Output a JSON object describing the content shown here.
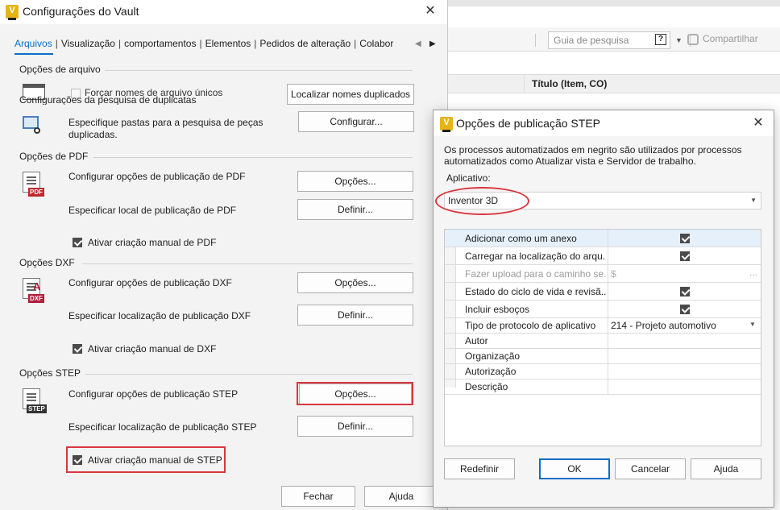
{
  "background_app": {
    "search_placeholder": "Guia de pesquisa",
    "search_help": "?",
    "share_label": "Compartilhar",
    "grid_column_title": "Título (Item, CO)"
  },
  "vault_dialog": {
    "title": "Configurações do Vault",
    "close_glyph": "✕",
    "tabs": [
      "Arquivos",
      "Visualização",
      "comportamentos",
      "Elementos",
      "Pedidos de alteração",
      "Colabor"
    ],
    "tab_separator": "|",
    "tab_scroll_left": "◀",
    "tab_scroll_right": "▶",
    "file_options": {
      "header": "Opções de arquivo",
      "force_unique_label": "Forçar nomes de arquivo únicos",
      "find_duplicates_button": "Localizar nomes duplicados",
      "duplicate_search_overlap": "Configurações da pesquisa de duplicatas",
      "folders_text": "Especifique pastas para a pesquisa de peças duplicadas.",
      "configure_button": "Configurar..."
    },
    "pdf": {
      "header": "Opções de PDF",
      "configure_text": "Configurar opções de publicação de PDF",
      "options_button": "Opções...",
      "location_text": "Especificar local de publicação de PDF",
      "define_button": "Definir...",
      "manual_label": "Ativar criação manual de PDF",
      "badge": "PDF"
    },
    "dxf": {
      "header": "Opções DXF",
      "configure_text": "Configurar opções de publicação DXF",
      "options_button": "Opções...",
      "location_text": "Especificar localização de publicação DXF",
      "define_button": "Definir...",
      "manual_label": "Ativar criação manual de DXF",
      "badge": "DXF",
      "badge_letter": "A"
    },
    "step": {
      "header": "Opções STEP",
      "configure_text": "Configurar opções de publicação STEP",
      "options_button": "Opções...",
      "location_text": "Especificar localização de publicação STEP",
      "define_button": "Definir...",
      "manual_label": "Ativar criação manual de STEP",
      "badge": "STEP"
    },
    "close_button": "Fechar",
    "help_button": "Ajuda"
  },
  "step_dialog": {
    "title": "Opções de publicação STEP",
    "close_glyph": "✕",
    "description": "Os processos automatizados em negrito são utilizados por processos automatizados como Atualizar vista e Servidor de trabalho.",
    "app_label": "Aplicativo:",
    "app_value": "Inventor 3D",
    "app_arrow": "▼",
    "properties": [
      {
        "name": "Adicionar como um anexo",
        "type": "check",
        "checked": true,
        "enabled": true,
        "selected": true
      },
      {
        "name": "Carregar na localização do arqu...",
        "type": "check",
        "checked": true,
        "enabled": true
      },
      {
        "name": "Fazer upload para o caminho se...",
        "type": "text",
        "value": "$",
        "extra": "...",
        "enabled": false
      },
      {
        "name": "Estado do ciclo de vida e revisã...",
        "type": "check",
        "checked": true,
        "enabled": true
      },
      {
        "name": "Incluir esboços",
        "type": "check",
        "checked": true,
        "enabled": true
      },
      {
        "name": "Tipo de protocolo de aplicativo",
        "type": "select",
        "value": "214 - Projeto automotivo",
        "arrow": "▼",
        "enabled": true
      },
      {
        "name": "Autor",
        "type": "text",
        "value": "",
        "enabled": true
      },
      {
        "name": "Organização",
        "type": "text",
        "value": "",
        "enabled": true
      },
      {
        "name": "Autorização",
        "type": "text",
        "value": "",
        "enabled": true
      },
      {
        "name": "Descrição",
        "type": "text",
        "value": "",
        "enabled": true
      }
    ],
    "buttons": {
      "reset": "Redefinir",
      "ok": "OK",
      "cancel": "Cancelar",
      "help": "Ajuda"
    }
  },
  "colors": {
    "accent_blue": "#0a6ec8",
    "annotation_red": "#d9363e",
    "vault_yellow": "#e7b416",
    "pdf_red": "#c0282e",
    "dxf_red": "#b01e3c",
    "step_dark": "#333333"
  }
}
